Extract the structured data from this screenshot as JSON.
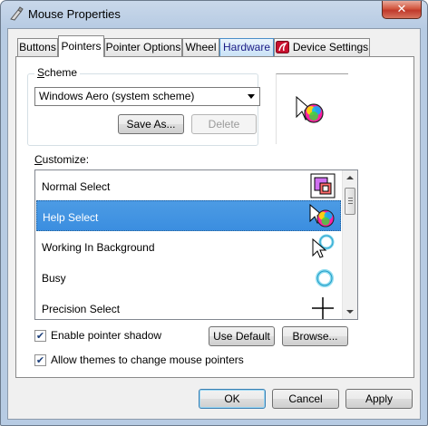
{
  "window": {
    "title": "Mouse Properties",
    "close_label": "✕",
    "icon": "mouse-properties-icon"
  },
  "tabs": [
    {
      "label": "Buttons"
    },
    {
      "label": "Pointers",
      "active": true
    },
    {
      "label": "Pointer Options"
    },
    {
      "label": "Wheel"
    },
    {
      "label": "Hardware",
      "highlighted": true
    },
    {
      "label": "Device Settings",
      "icon": "synaptics-icon"
    }
  ],
  "scheme": {
    "group_label": "Scheme",
    "selected": "Windows Aero (system scheme)",
    "save_as_label": "Save As...",
    "delete_label": "Delete",
    "preview_icon": "help-select-cursor-icon"
  },
  "customize": {
    "label": "Customize:",
    "items": [
      {
        "label": "Normal Select",
        "icon": "normal-select-cursor-icon"
      },
      {
        "label": "Help Select",
        "icon": "help-select-cursor-icon",
        "selected": true
      },
      {
        "label": "Working In Background",
        "icon": "working-in-background-cursor-icon"
      },
      {
        "label": "Busy",
        "icon": "busy-cursor-icon"
      },
      {
        "label": "Precision Select",
        "icon": "precision-select-cursor-icon"
      }
    ]
  },
  "options": {
    "pointer_shadow_label": "Enable pointer shadow",
    "pointer_shadow_checked": true,
    "themes_label": "Allow themes to change mouse pointers",
    "themes_checked": true,
    "check_mark": "✔",
    "use_default_label": "Use Default",
    "browse_label": "Browse..."
  },
  "footer": {
    "ok_label": "OK",
    "cancel_label": "Cancel",
    "apply_label": "Apply"
  },
  "colors": {
    "selection": "#3b8ee0",
    "close_button": "#c0392b",
    "hardware_tab_text": "#1c1c86"
  }
}
